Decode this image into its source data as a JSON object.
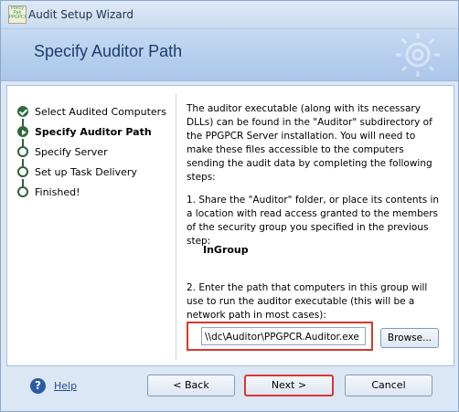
{
  "window": {
    "app_icon_text": "Policy Pak PPGPCR",
    "title": "Audit Setup Wizard"
  },
  "header": {
    "title": "Specify Auditor Path",
    "icon": "gear-icon"
  },
  "steps": [
    {
      "label": "Select Audited Computers",
      "state": "done"
    },
    {
      "label": "Specify Auditor Path",
      "state": "current"
    },
    {
      "label": "Specify Server",
      "state": "pending"
    },
    {
      "label": "Set up Task Delivery",
      "state": "pending"
    },
    {
      "label": "Finished!",
      "state": "pending"
    }
  ],
  "main": {
    "para1": "The auditor executable (along with its necessary DLLs) can be found in the \"Auditor\" subdirectory of the PPGPCR Server installation.  You will need to make these files accessible to the computers sending the audit data by completing the following steps:",
    "para2": "1. Share the \"Auditor\" folder, or place its contents in a location with read access granted to the members of the security group you specified in the previous step:",
    "group_name": "InGroup",
    "para3": "2. Enter the path that computers in this group will use to run the auditor executable (this will be a network path in most cases):",
    "path_value": "\\\\dc\\Auditor\\PPGPCR.Auditor.exe",
    "browse_label": "Browse..."
  },
  "footer": {
    "help_icon_glyph": "?",
    "help_label": "Help",
    "back_label": "<  Back",
    "next_label": "Next  >",
    "cancel_label": "Cancel"
  },
  "colors": {
    "highlight": "#d8382e",
    "step_green": "#2f6a3e",
    "header_text": "#1e3d6c"
  }
}
